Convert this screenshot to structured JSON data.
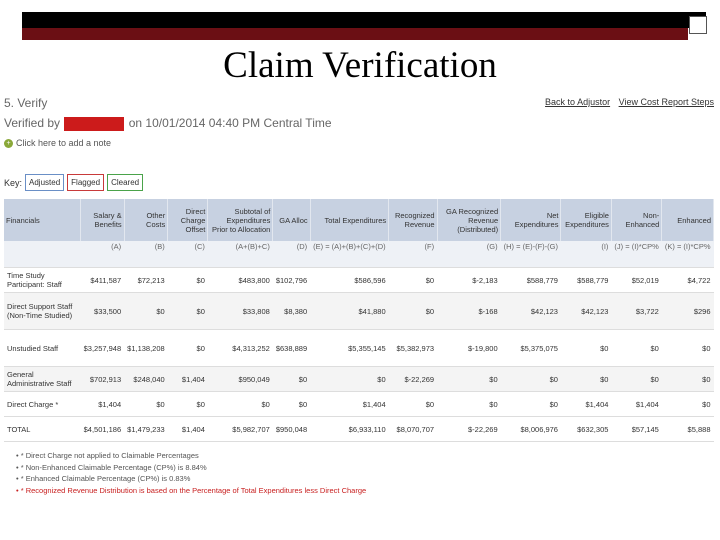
{
  "slide": {
    "title": "Claim Verification"
  },
  "page": {
    "step_title": "5. Verify",
    "verified_prefix": "Verified by",
    "verified_suffix": "on 10/01/2014 04:40 PM Central Time",
    "links": [
      "Back to Adjustor",
      "View Cost Report Steps"
    ],
    "note": "Click here to add a note",
    "key_label": "Key:",
    "key_items": [
      "Adjusted",
      "Flagged",
      "Cleared"
    ]
  },
  "colors": {
    "top_black": "#000000",
    "top_red": "#6b0f14",
    "header": "#c7d1e1",
    "redaction": "#cc1b1b",
    "alert": "#c82020"
  },
  "table": {
    "headers": [
      "Financials",
      "Salary & Benefits",
      "Other Costs",
      "Direct Charge Offset",
      "Subtotal of Expenditures Prior to Allocation",
      "GA Alloc",
      "Total Expenditures",
      "Recognized Revenue",
      "GA Recognized Revenue (Distributed)",
      "Net Expenditures",
      "Eligible Expenditures",
      "Non-Enhanced",
      "Enhanced"
    ],
    "formulas": [
      "",
      "(A)",
      "(B)",
      "(C)",
      "(A+(B)+C)",
      "(D)",
      "(E) = (A)+(B)+(C)+(D)",
      "(F)",
      "(G)",
      "(H) = (E)-(F)-(G)",
      "(I)",
      "(J) = (I)*CP%",
      "(K) = (I)*CP%"
    ],
    "rows": [
      [
        "Time Study Participant: Staff",
        "$411,587",
        "$72,213",
        "$0",
        "$483,800",
        "$102,796",
        "$586,596",
        "$0",
        "$-2,183",
        "$588,779",
        "$588,779",
        "$52,019",
        "$4,722"
      ],
      [
        "Direct Support Staff (Non-Time Studied)",
        "$33,500",
        "$0",
        "$0",
        "$33,808",
        "$8,380",
        "$41,880",
        "$0",
        "$-168",
        "$42,123",
        "$42,123",
        "$3,722",
        "$296"
      ],
      [
        "Unstudied Staff",
        "$3,257,948",
        "$1,138,208",
        "$0",
        "$4,313,252",
        "$638,889",
        "$5,355,145",
        "$5,382,973",
        "$-19,800",
        "$5,375,075",
        "$0",
        "$0",
        "$0"
      ],
      [
        "General Administrative Staff",
        "$702,913",
        "$248,040",
        "$1,404",
        "$950,049",
        "$0",
        "$0",
        "$-22,269",
        "$0",
        "$0",
        "$0",
        "$0",
        "$0"
      ],
      [
        "Direct Charge *",
        "$1,404",
        "$0",
        "$0",
        "$0",
        "$0",
        "$1,404",
        "$0",
        "$0",
        "$0",
        "$1,404",
        "$1,404",
        "$0"
      ],
      [
        "TOTAL",
        "$4,501,186",
        "$1,479,233",
        "$1,404",
        "$5,982,707",
        "$950,048",
        "$6,933,110",
        "$8,070,707",
        "$-22,269",
        "$8,006,976",
        "$632,305",
        "$57,145",
        "$5,888"
      ]
    ]
  },
  "footnotes": [
    "* Direct Charge not applied to Claimable Percentages",
    "* Non-Enhanced Claimable Percentage (CP%) is 8.84%",
    "* Enhanced Claimable Percentage (CP%) is 0.83%",
    "* Recognized Revenue Distribution is based on the Percentage of Total Expenditures less Direct Charge"
  ]
}
